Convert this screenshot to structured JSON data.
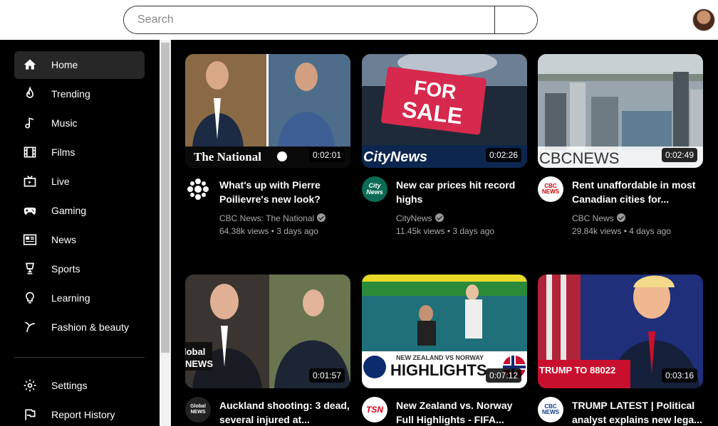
{
  "search": {
    "placeholder": "Search"
  },
  "sidebar": {
    "items": [
      {
        "label": "Home",
        "icon": "home-icon",
        "active": true
      },
      {
        "label": "Trending",
        "icon": "flame-icon"
      },
      {
        "label": "Music",
        "icon": "music-note-icon"
      },
      {
        "label": "Films",
        "icon": "film-icon"
      },
      {
        "label": "Live",
        "icon": "live-tv-icon"
      },
      {
        "label": "Gaming",
        "icon": "gamepad-icon"
      },
      {
        "label": "News",
        "icon": "newspaper-icon"
      },
      {
        "label": "Sports",
        "icon": "trophy-icon"
      },
      {
        "label": "Learning",
        "icon": "lightbulb-icon"
      },
      {
        "label": "Fashion & beauty",
        "icon": "hanger-icon"
      }
    ],
    "bottom_items": [
      {
        "label": "Settings",
        "icon": "gear-icon"
      },
      {
        "label": "Report History",
        "icon": "flag-icon"
      }
    ]
  },
  "videos": [
    {
      "title": "What's up with Pierre Poilievre's new look?",
      "channel": "CBC News: The National",
      "views": "64.38k views",
      "age": "3 days ago",
      "duration": "0:02:01",
      "overlay": "The National",
      "avatar": "cbc-logo"
    },
    {
      "title": "New car prices hit record highs",
      "channel": "CityNews",
      "views": "11.45k views",
      "age": "3 days ago",
      "duration": "0:02:26",
      "overlay": "CityNews",
      "sign": "FOR SALE",
      "avatar_text": "City News"
    },
    {
      "title": "Rent unaffordable in most Canadian cities for...",
      "channel": "CBC News",
      "views": "29.84k views",
      "age": "4 days ago",
      "duration": "0:02:49",
      "overlay": "CBCNEWS",
      "avatar_text": "CBC NEWS"
    },
    {
      "title": "Auckland shooting: 3 dead, several injured at...",
      "channel": "",
      "views": "",
      "age": "",
      "duration": "0:01:57",
      "overlay": "lobal NEWS",
      "avatar_text": "Global NEWS"
    },
    {
      "title": "New Zealand vs. Norway Full Highlights - FIFA...",
      "channel": "",
      "views": "",
      "age": "",
      "duration": "0:07:12",
      "overlay": "HIGHLIGHTS",
      "overlay_sub": "NEW ZEALAND VS NORWAY",
      "avatar_text": "TSN"
    },
    {
      "title": "TRUMP LATEST | Political analyst explains new lega...",
      "channel": "",
      "views": "",
      "age": "",
      "duration": "0:03:16",
      "overlay": "TRUMP TO 88022",
      "avatar_text": "CBC NEWS"
    }
  ],
  "colors": {
    "accent_active": "#272727",
    "background": "#000000",
    "meta_text": "#aaaaaa"
  }
}
